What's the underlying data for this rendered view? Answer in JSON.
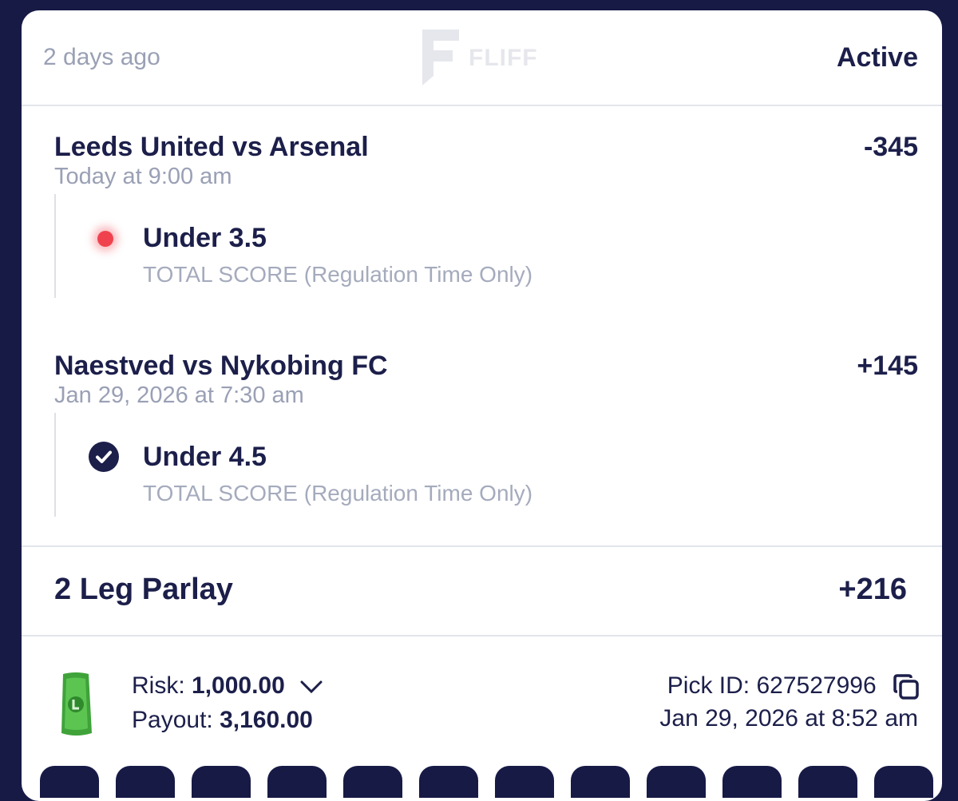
{
  "header": {
    "posted": "2 days ago",
    "brand": "FLIFF",
    "status": "Active"
  },
  "legs": [
    {
      "match": "Leeds United vs Arsenal",
      "odds": "-345",
      "when": "Today at 9:00 am",
      "pick": "Under 3.5",
      "market": "TOTAL SCORE",
      "market_note": "(Regulation Time Only)",
      "state": "live-dot"
    },
    {
      "match": "Naestved vs Nykobing FC",
      "odds": "+145",
      "when": "Jan 29, 2026 at 7:30 am",
      "pick": "Under 4.5",
      "market": "TOTAL SCORE",
      "market_note": "(Regulation Time Only)",
      "state": "check-icon"
    }
  ],
  "parlay": {
    "title": "2 Leg Parlay",
    "odds": "+216"
  },
  "footer": {
    "risk_label": "Risk:",
    "risk_value": "1,000.00",
    "payout_label": "Payout:",
    "payout_value": "3,160.00",
    "pick_id_label": "Pick ID:",
    "pick_id": "627527996",
    "placed_at": "Jan 29, 2026 at 8:52 am"
  },
  "colors": {
    "background": "#171a45",
    "text_primary": "#1c1f4a",
    "text_muted": "#9aa0b5",
    "live_red": "#f0424e",
    "money_green": "#3fa33a"
  }
}
